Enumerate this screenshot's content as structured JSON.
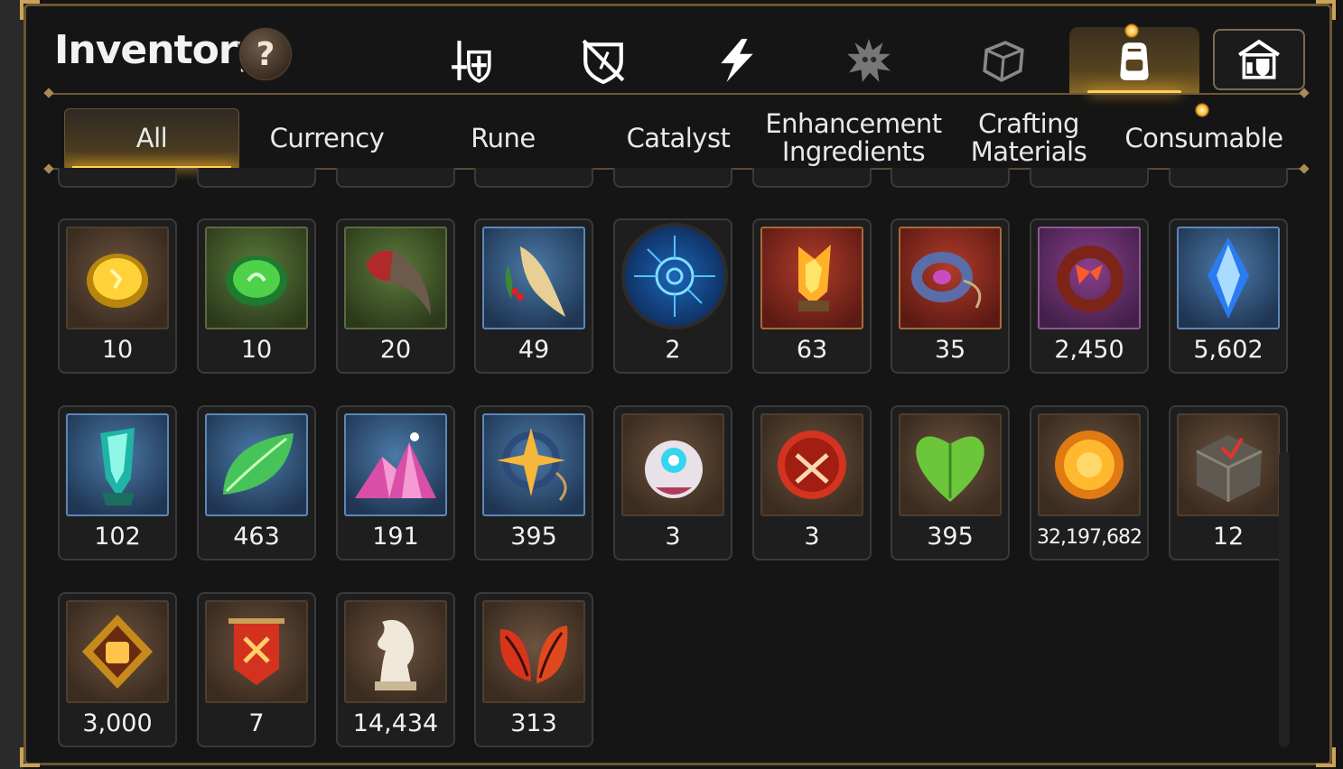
{
  "header": {
    "title": "Inventory",
    "help_label": "?"
  },
  "top_tabs": [
    {
      "icon": "sword-shield-icon",
      "active": false
    },
    {
      "icon": "broken-shield-icon",
      "active": false
    },
    {
      "icon": "lightning-icon",
      "active": false
    },
    {
      "icon": "splat-monster-icon",
      "active": false
    },
    {
      "icon": "dice-box-icon",
      "active": false
    },
    {
      "icon": "backpack-icon",
      "active": true
    },
    {
      "icon": "storage-house-icon",
      "active": false
    }
  ],
  "sub_tabs": [
    {
      "label": "All",
      "active": true
    },
    {
      "label": "Currency",
      "active": false
    },
    {
      "label": "Rune",
      "active": false
    },
    {
      "label": "Catalyst",
      "active": false
    },
    {
      "label": "Enhancement\nIngredients",
      "active": false
    },
    {
      "label": "Crafting\nMaterials",
      "active": false
    },
    {
      "label": "Consumable",
      "active": false
    }
  ],
  "items": [
    {
      "icon": "gold-gem-icon",
      "count": "10"
    },
    {
      "icon": "green-gem-icon",
      "count": "10"
    },
    {
      "icon": "claw-icon",
      "count": "20"
    },
    {
      "icon": "root-herb-icon",
      "count": "49"
    },
    {
      "icon": "blue-rune-orb-icon",
      "count": "2"
    },
    {
      "icon": "fire-crystal-icon",
      "count": "63"
    },
    {
      "icon": "ring-charm-icon",
      "count": "35"
    },
    {
      "icon": "red-bangle-icon",
      "count": "2,450"
    },
    {
      "icon": "blue-crystal-icon",
      "count": "5,602"
    },
    {
      "icon": "teal-crystal-icon",
      "count": "102"
    },
    {
      "icon": "leaf-icon",
      "count": "463"
    },
    {
      "icon": "pink-crystal-pile-icon",
      "count": "191"
    },
    {
      "icon": "star-pendant-icon",
      "count": "395"
    },
    {
      "icon": "robot-pod-icon",
      "count": "3"
    },
    {
      "icon": "battle-emblem-icon",
      "count": "3"
    },
    {
      "icon": "green-heart-icon",
      "count": "395"
    },
    {
      "icon": "sun-coin-icon",
      "count": "32,197,682"
    },
    {
      "icon": "compass-cube-icon",
      "count": "12"
    },
    {
      "icon": "fist-badge-icon",
      "count": "3,000"
    },
    {
      "icon": "war-banner-icon",
      "count": "7"
    },
    {
      "icon": "chess-knight-icon",
      "count": "14,434"
    },
    {
      "icon": "red-leaves-icon",
      "count": "313"
    }
  ],
  "colors": {
    "accent": "#ffcf5a",
    "frame": "#6b5633",
    "text": "#f1f1f1"
  }
}
